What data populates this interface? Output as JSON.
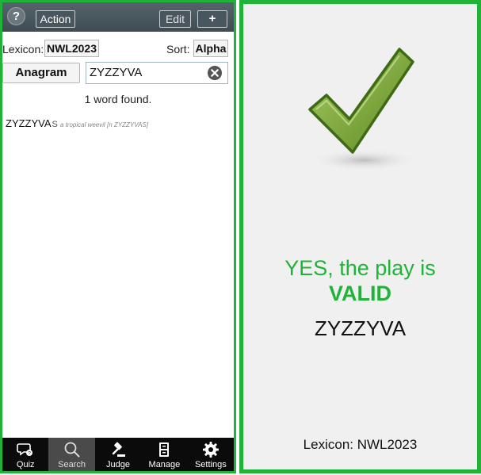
{
  "left": {
    "topbar": {
      "help_label": "?",
      "action_label": "Action",
      "edit_label": "Edit",
      "add_label": "+"
    },
    "options": {
      "lexicon_label": "Lexicon:",
      "lexicon_value": "NWL2023",
      "sort_label": "Sort:",
      "sort_value": "Alpha"
    },
    "search": {
      "mode_label": "Anagram",
      "query": "ZYZZYVA"
    },
    "results": {
      "count_text": "1 word found.",
      "items": [
        {
          "word": "ZYZZYVA",
          "hook": "S",
          "definition": "a tropical weevil [n ZYZZYVAS]"
        }
      ]
    },
    "nav": [
      {
        "label": "Quiz",
        "icon": "quiz-icon",
        "active": false
      },
      {
        "label": "Search",
        "icon": "search-icon",
        "active": true
      },
      {
        "label": "Judge",
        "icon": "gavel-icon",
        "active": false
      },
      {
        "label": "Manage",
        "icon": "cabinet-icon",
        "active": false
      },
      {
        "label": "Settings",
        "icon": "gear-icon",
        "active": false
      }
    ]
  },
  "right": {
    "icon": "checkmark-icon",
    "verdict_line1": "YES, the play is",
    "verdict_line2": "VALID",
    "word": "ZYZZYVA",
    "lexicon_text": "Lexicon: NWL2023"
  },
  "colors": {
    "valid_green": "#1fb437",
    "topbar": "#4b585f",
    "nav_bg": "#0b0b0b"
  }
}
